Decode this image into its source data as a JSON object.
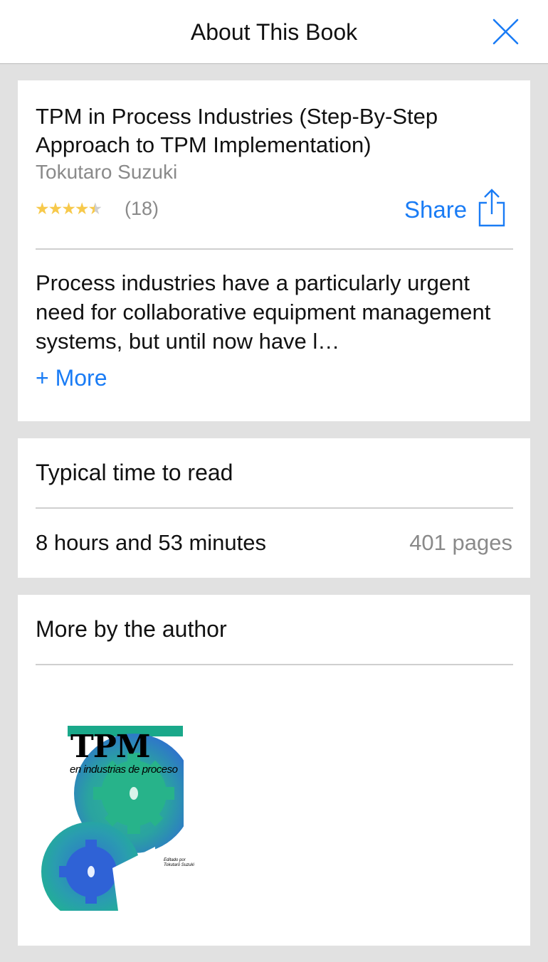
{
  "header": {
    "title": "About This Book",
    "close_icon": "close-icon"
  },
  "book": {
    "title": "TPM in Process Industries (Step-By-Step Approach to TPM Implementation)",
    "author": "Tokutaro Suzuki",
    "rating": 4.5,
    "rating_max": 5,
    "rating_count": "(18)",
    "share_label": "Share",
    "share_icon": "share-icon",
    "description": "Process industries have a particularly urgent need for collaborative equipment management systems, but until now have l…",
    "more_label": "+ More"
  },
  "reading": {
    "title": "Typical time to read",
    "time": "8 hours and 53 minutes",
    "pages": "401 pages"
  },
  "more_by_author": {
    "title": "More by the author",
    "books": [
      {
        "cover_title": "TPM",
        "cover_subtitle": "en industrias de proceso",
        "cover_editor_label": "Editado por",
        "cover_editor_name": "Tokutarō Suzuki"
      }
    ]
  },
  "colors": {
    "accent": "#1a7cf5",
    "star": "#f7c94b",
    "secondary_text": "#8a8a8a",
    "background": "#e1e1e1",
    "cover_teal": "#1aa88a",
    "cover_blue": "#2f6fd0"
  }
}
